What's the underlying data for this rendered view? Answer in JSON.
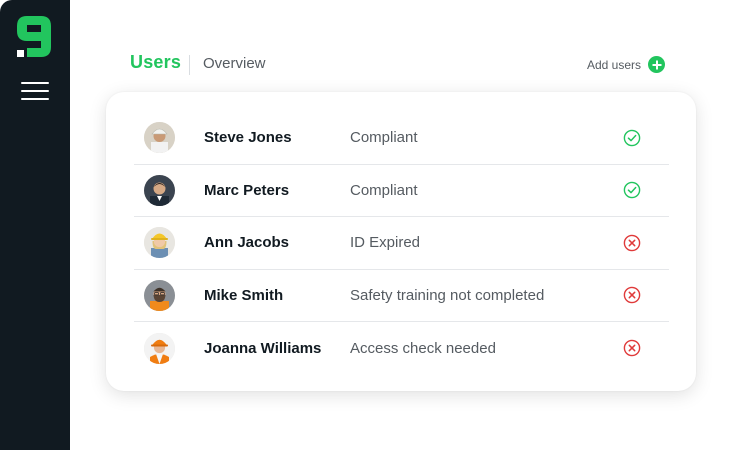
{
  "colors": {
    "sidebar": "#111a21",
    "accent": "#22c55e",
    "ok": "#22c55e",
    "error": "#e03a3a"
  },
  "sidebar": {
    "logo_icon": "brand-logo",
    "menu_icon": "hamburger-menu-icon"
  },
  "header": {
    "tabs": [
      {
        "label": "Users",
        "active": true
      },
      {
        "label": "Overview",
        "active": false
      }
    ],
    "add_users_label": "Add users",
    "add_users_icon": "plus-circle-icon"
  },
  "users": [
    {
      "name": "Steve Jones",
      "status": "Compliant",
      "status_icon": "check-circle-icon",
      "ok": true
    },
    {
      "name": "Marc Peters",
      "status": "Compliant",
      "status_icon": "check-circle-icon",
      "ok": true
    },
    {
      "name": "Ann Jacobs",
      "status": "ID Expired",
      "status_icon": "x-circle-icon",
      "ok": false
    },
    {
      "name": "Mike Smith",
      "status": "Safety training not completed",
      "status_icon": "x-circle-icon",
      "ok": false
    },
    {
      "name": "Joanna Williams",
      "status": "Access check needed",
      "status_icon": "x-circle-icon",
      "ok": false
    }
  ]
}
